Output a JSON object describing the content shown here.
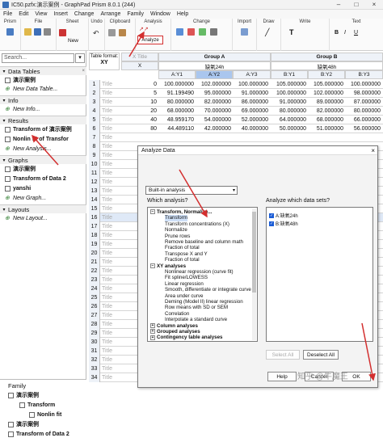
{
  "window": {
    "title": "IC50.pzfx:演示案例 - GraphPad Prism 8.0.1 (244)"
  },
  "menu": [
    "File",
    "Edit",
    "View",
    "Insert",
    "Change",
    "Arrange",
    "Family",
    "Window",
    "Help"
  ],
  "ribbon": {
    "groups": [
      "Prism",
      "File",
      "Sheet",
      "Undo",
      "Clipboard",
      "Analysis",
      "Change",
      "Import",
      "Draw",
      "Write",
      "Text"
    ],
    "new_label": "New",
    "analyze_label": "Analyze"
  },
  "sidebar": {
    "search_placeholder": "Search...",
    "sections": [
      {
        "title": "Data Tables",
        "items": [
          {
            "label": "演示案例",
            "style": "bold"
          },
          {
            "label": "New Data Table...",
            "style": "ital"
          }
        ]
      },
      {
        "title": "Info",
        "items": [
          {
            "label": "New Info...",
            "style": "ital"
          }
        ]
      },
      {
        "title": "Results",
        "items": [
          {
            "label": "Transform of 演示案例",
            "style": "bold"
          },
          {
            "label": "Nonlin fit of Transfor",
            "style": "bold"
          },
          {
            "label": "New Analysis...",
            "style": "ital"
          }
        ]
      },
      {
        "title": "Graphs",
        "items": [
          {
            "label": "演示案例",
            "style": "bold"
          },
          {
            "label": "Transform of Data 2",
            "style": "bold"
          },
          {
            "label": "yanshi",
            "style": "bold"
          },
          {
            "label": "New Graph...",
            "style": "ital"
          }
        ]
      },
      {
        "title": "Layouts",
        "items": [
          {
            "label": "New Layout...",
            "style": "ital"
          }
        ]
      }
    ],
    "family": {
      "title": "Family",
      "items": [
        "演示案例",
        "Transform",
        "Nonlin fit",
        "演示案例",
        "Transform of Data 2"
      ]
    }
  },
  "table": {
    "format_label": "Table format:",
    "format_value": "XY",
    "x_title": "X Title",
    "x_col": "X",
    "group_a": "Group A",
    "group_a_name": "缺氧24h",
    "group_b": "Group B",
    "group_b_name": "缺氧48h",
    "col_ids": [
      "A:Y1",
      "A:Y2",
      "A:Y3",
      "B:Y1",
      "B:Y2",
      "B:Y3"
    ],
    "row_title": "Title",
    "rows": [
      {
        "n": "1",
        "x": "0",
        "v": [
          "100.000000",
          "102.000000",
          "100.000000",
          "105.000000",
          "105.000000",
          "100.000000"
        ]
      },
      {
        "n": "2",
        "x": "5",
        "v": [
          "91.199490",
          "95.000000",
          "91.000000",
          "100.000000",
          "102.000000",
          "98.000000"
        ]
      },
      {
        "n": "3",
        "x": "10",
        "v": [
          "80.000000",
          "82.000000",
          "86.000000",
          "91.000000",
          "89.000000",
          "87.000000"
        ]
      },
      {
        "n": "4",
        "x": "20",
        "v": [
          "68.000000",
          "70.000000",
          "69.000000",
          "80.000000",
          "82.000000",
          "80.000000"
        ]
      },
      {
        "n": "5",
        "x": "40",
        "v": [
          "48.959170",
          "54.000000",
          "52.000000",
          "64.000000",
          "68.000000",
          "66.000000"
        ]
      },
      {
        "n": "6",
        "x": "80",
        "v": [
          "44.489110",
          "42.000000",
          "40.000000",
          "50.000000",
          "51.000000",
          "56.000000"
        ]
      },
      {
        "n": "7",
        "x": "",
        "v": [
          "",
          "",
          "",
          "",
          "",
          ""
        ]
      },
      {
        "n": "8",
        "x": "",
        "v": [
          "",
          "",
          "",
          "",
          "",
          ""
        ]
      },
      {
        "n": "9",
        "x": "",
        "v": [
          "",
          "",
          "",
          "",
          "",
          ""
        ]
      },
      {
        "n": "10",
        "x": "",
        "v": [
          "",
          "",
          "",
          "",
          "",
          ""
        ]
      },
      {
        "n": "11",
        "x": "",
        "v": [
          "",
          "",
          "",
          "",
          "",
          ""
        ]
      },
      {
        "n": "12",
        "x": "",
        "v": [
          "",
          "",
          "",
          "",
          "",
          ""
        ]
      },
      {
        "n": "13",
        "x": "",
        "v": [
          "",
          "",
          "",
          "",
          "",
          ""
        ]
      },
      {
        "n": "14",
        "x": "",
        "v": [
          "",
          "",
          "",
          "",
          "",
          ""
        ]
      },
      {
        "n": "15",
        "x": "",
        "v": [
          "",
          "",
          "",
          "",
          "",
          ""
        ]
      },
      {
        "n": "16",
        "x": "",
        "v": [
          "",
          "",
          "",
          "",
          "",
          ""
        ]
      },
      {
        "n": "17",
        "x": "",
        "v": [
          "",
          "",
          "",
          "",
          "",
          ""
        ]
      },
      {
        "n": "18",
        "x": "",
        "v": [
          "",
          "",
          "",
          "",
          "",
          ""
        ]
      },
      {
        "n": "19",
        "x": "",
        "v": [
          "",
          "",
          "",
          "",
          "",
          ""
        ]
      },
      {
        "n": "20",
        "x": "",
        "v": [
          "",
          "",
          "",
          "",
          "",
          ""
        ]
      },
      {
        "n": "21",
        "x": "",
        "v": [
          "",
          "",
          "",
          "",
          "",
          ""
        ]
      },
      {
        "n": "22",
        "x": "",
        "v": [
          "",
          "",
          "",
          "",
          "",
          ""
        ]
      },
      {
        "n": "23",
        "x": "",
        "v": [
          "",
          "",
          "",
          "",
          "",
          ""
        ]
      },
      {
        "n": "24",
        "x": "",
        "v": [
          "",
          "",
          "",
          "",
          "",
          ""
        ]
      },
      {
        "n": "25",
        "x": "",
        "v": [
          "",
          "",
          "",
          "",
          "",
          ""
        ]
      },
      {
        "n": "26",
        "x": "",
        "v": [
          "",
          "",
          "",
          "",
          "",
          ""
        ]
      },
      {
        "n": "27",
        "x": "",
        "v": [
          "",
          "",
          "",
          "",
          "",
          ""
        ]
      },
      {
        "n": "28",
        "x": "",
        "v": [
          "",
          "",
          "",
          "",
          "",
          ""
        ]
      },
      {
        "n": "29",
        "x": "",
        "v": [
          "",
          "",
          "",
          "",
          "",
          ""
        ]
      },
      {
        "n": "30",
        "x": "",
        "v": [
          "",
          "",
          "",
          "",
          "",
          ""
        ]
      },
      {
        "n": "31",
        "x": "",
        "v": [
          "",
          "",
          "",
          "",
          "",
          ""
        ]
      },
      {
        "n": "32",
        "x": "",
        "v": [
          "",
          "",
          "",
          "",
          "",
          ""
        ]
      },
      {
        "n": "33",
        "x": "",
        "v": [
          "",
          "",
          "",
          "",
          "",
          ""
        ]
      },
      {
        "n": "34",
        "x": "",
        "v": [
          "",
          "",
          "",
          "",
          "",
          ""
        ]
      }
    ]
  },
  "dialog": {
    "title": "Analyze Data",
    "source": "Built-in analysis",
    "which_label": "Which analysis?",
    "sets_label": "Analyze which data sets?",
    "tree": [
      {
        "label": "Transform, Normalize...",
        "type": "parent",
        "expanded": true
      },
      {
        "label": "Transform",
        "type": "child"
      },
      {
        "label": "Transform concentrations (X)",
        "type": "child"
      },
      {
        "label": "Normalize",
        "type": "child"
      },
      {
        "label": "Prune rows",
        "type": "child"
      },
      {
        "label": "Remove baseline and column math",
        "type": "child"
      },
      {
        "label": "Fraction of total",
        "type": "child"
      },
      {
        "label": "Transpose X and Y",
        "type": "child"
      },
      {
        "label": "Fraction of total",
        "type": "child"
      },
      {
        "label": "XY analyses",
        "type": "parent",
        "expanded": true
      },
      {
        "label": "Nonlinear regression (curve fit)",
        "type": "child"
      },
      {
        "label": "Fit spline/LOWESS",
        "type": "child"
      },
      {
        "label": "Linear regression",
        "type": "child"
      },
      {
        "label": "Smooth, differentiate or integrate curve",
        "type": "child"
      },
      {
        "label": "Area under curve",
        "type": "child"
      },
      {
        "label": "Deming (Model II) linear regression",
        "type": "child"
      },
      {
        "label": "Row means with SD or SEM",
        "type": "child"
      },
      {
        "label": "Correlation",
        "type": "child"
      },
      {
        "label": "Interpolate a standard curve",
        "type": "child"
      },
      {
        "label": "Column analyses",
        "type": "parent",
        "expanded": false
      },
      {
        "label": "Grouped analyses",
        "type": "parent",
        "expanded": false
      },
      {
        "label": "Contingency table analyses",
        "type": "parent",
        "expanded": false
      }
    ],
    "sets": [
      "A:缺氧24h",
      "B:缺氧48h"
    ],
    "select_all": "Select All",
    "deselect_all": "Deselect All",
    "help": "Help",
    "cancel": "Cancel",
    "ok": "OK"
  },
  "watermark": "知乎 @牛魔王",
  "colors": {
    "accent": "#1a5cd6",
    "annotation": "#d32f2f"
  }
}
